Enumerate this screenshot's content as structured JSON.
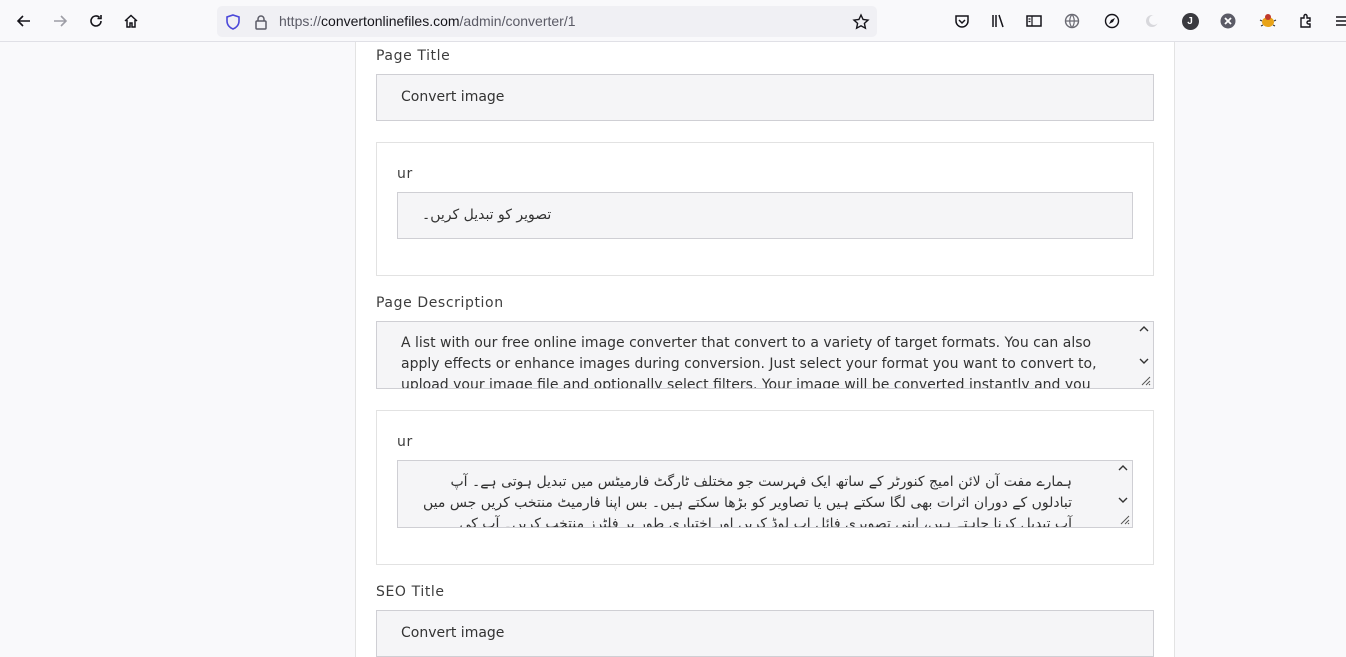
{
  "browser": {
    "url_prefix": "https://",
    "url_host": "convertonlinefiles.com",
    "url_path": "/admin/converter/1",
    "profile_initial": "J"
  },
  "form": {
    "page_title_label": "Page Title",
    "page_title_value": "Convert image",
    "page_title_ur_label": "ur",
    "page_title_ur_value": "تصویر کو تبدیل کریں۔",
    "page_description_label": "Page Description",
    "page_description_value": "A list with our free online image converter that convert to a variety of target formats. You can also apply effects or enhance images during conversion. Just select your format you want to convert to, upload your image file and optionally select filters. Your image will be converted instantly and you can download the result after only a",
    "page_description_ur_label": "ur",
    "page_description_ur_value": "ہمارے مفت آن لائن امیج کنورٹر کے ساتھ ایک فہرست جو مختلف ٹارگٹ فارمیٹس میں تبدیل ہوتی ہے۔ آپ تبادلوں کے دوران اثرات بھی لگا سکتے ہیں یا تصاویر کو بڑھا سکتے ہیں۔ بس اپنا فارمیٹ منتخب کریں جس میں آپ تبدیل کرنا چاہتے ہیں، اپنی تصویری فائل اپ لوڈ کریں اور اختیاری طور پر فلٹرز منتخب کریں۔ آپ کی تصویر فوری طور پر تبدیل ہو جائے",
    "seo_title_label": "SEO Title",
    "seo_title_value": "Convert image"
  }
}
